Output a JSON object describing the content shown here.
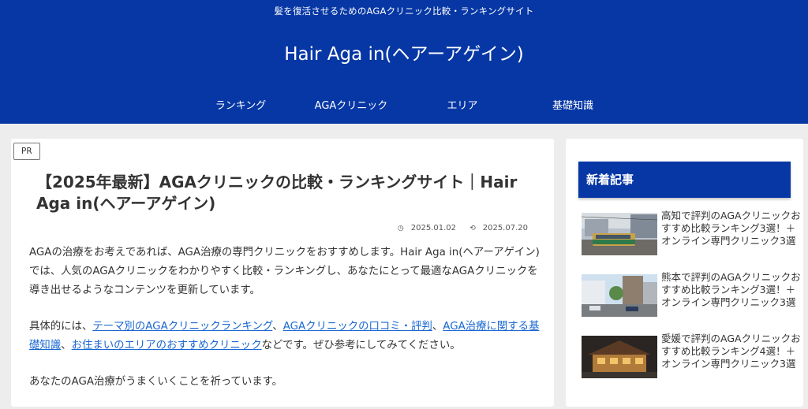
{
  "header": {
    "tagline": "髪を復活させるためのAGAクリニック比較・ランキングサイト",
    "site_title": "Hair Aga in(ヘアーアゲイン)",
    "nav": [
      "ランキング",
      "AGAクリニック",
      "エリア",
      "基礎知識"
    ]
  },
  "article": {
    "badge": "PR",
    "title": "【2025年最新】AGAクリニックの比較・ランキングサイト｜Hair Aga in(ヘアーアゲイン)",
    "published": "2025.01.02",
    "updated": "2025.07.20",
    "para1": "AGAの治療をお考えであれば、AGA治療の専門クリニックをおすすめします。Hair Aga in(ヘアーアゲイン)では、人気のAGAクリニックをわかりやすく比較・ランキングし、あなたにとって最適なAGAクリニックを導き出せるようなコンテンツを更新しています。",
    "para2_prefix": "具体的には、",
    "link1": "テーマ別のAGAクリニックランキング",
    "sep1": "、",
    "link2": "AGAクリニックの口コミ・評判",
    "sep2": "、",
    "link3": "AGA治療に関する基礎知識",
    "sep3": "、",
    "link4": "お住まいのエリアのおすすめクリニック",
    "para2_suffix": "などです。ぜひ参考にしてみてください。",
    "para3": "あなたのAGA治療がうまくいくことを祈っています。"
  },
  "sidebar": {
    "heading": "新着記事",
    "posts": [
      {
        "title": "高知で評判のAGAクリニックおすすめ比較ランキング3選！＋オンライン専門クリニック3選",
        "thumb": "tram-street"
      },
      {
        "title": "熊本で評判のAGAクリニックおすすめ比較ランキング3選！＋オンライン専門クリニック3選",
        "thumb": "city-road"
      },
      {
        "title": "愛媛で評判のAGAクリニックおすすめ比較ランキング4選！＋オンライン専門クリニック3選",
        "thumb": "onsen-night"
      }
    ]
  },
  "colors": {
    "brand_blue": "#0637a5",
    "link_blue": "#1967d2"
  }
}
